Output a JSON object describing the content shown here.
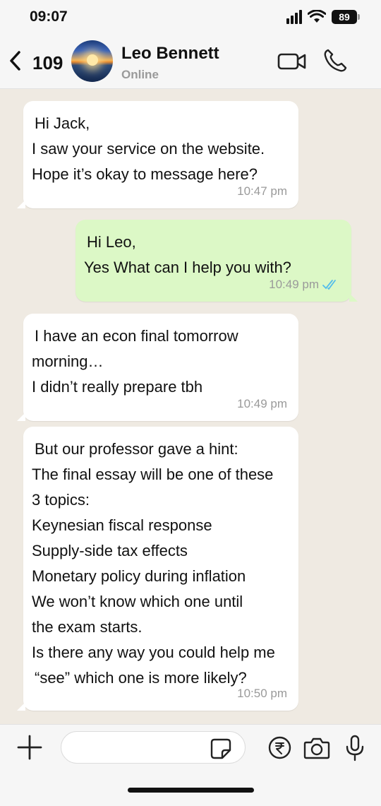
{
  "status_bar": {
    "time": "09:07",
    "battery": "89",
    "icons": [
      "signal-icon",
      "wifi-icon",
      "battery-icon"
    ]
  },
  "header": {
    "back_count": "109",
    "contact_name": "Leo Bennett",
    "contact_status": "Online",
    "icons": [
      "back-chevron-icon",
      "avatar",
      "video-call-icon",
      "voice-call-icon"
    ]
  },
  "messages": [
    {
      "direction": "incoming",
      "lines": [
        "Hi Jack,",
        "I saw your service on the website.",
        "Hope it’s okay to message here?"
      ],
      "time": "10:47 pm"
    },
    {
      "direction": "outgoing",
      "lines": [
        "Hi Leo,",
        "Yes What can I help you with?"
      ],
      "time": "10:49 pm",
      "status": "read"
    },
    {
      "direction": "incoming",
      "lines": [
        "I have an econ final tomorrow",
        "morning…",
        "I didn’t really prepare tbh"
      ],
      "time": "10:49 pm"
    },
    {
      "direction": "incoming",
      "lines": [
        "But our professor gave a hint:",
        "The final essay will be one of these",
        "3 topics:",
        "Keynesian fiscal response",
        "Supply-side tax effects",
        "Monetary policy during inflation",
        "We won’t know which one until",
        "the exam starts.",
        "Is there any way you could help me",
        "“see” which one is more likely?"
      ],
      "time": "10:50 pm"
    }
  ],
  "input_bar": {
    "placeholder": "",
    "icons": [
      "plus-icon",
      "sticker-icon",
      "rupee-payment-icon",
      "camera-icon",
      "microphone-icon"
    ]
  },
  "colors": {
    "chat_background": "#efeae2",
    "incoming_bubble": "#ffffff",
    "outgoing_bubble": "#dcf8c6",
    "read_receipt": "#53bdeb",
    "timestamp": "#9a9a9a"
  }
}
